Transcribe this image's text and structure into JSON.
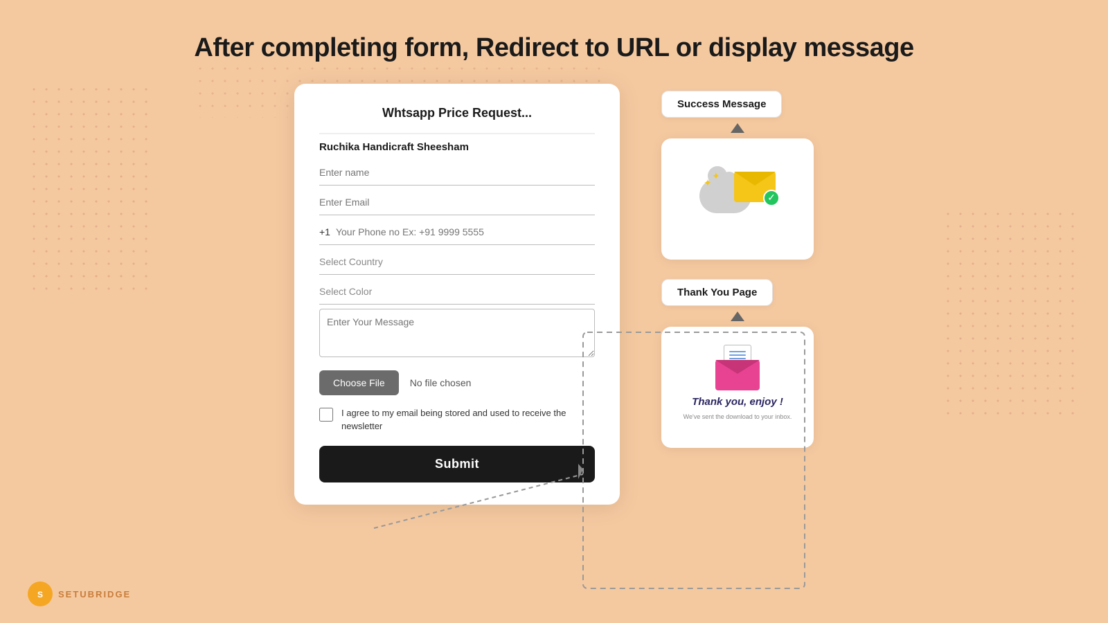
{
  "page": {
    "title": "After completing form, Redirect to URL or display message",
    "background_color": "#f5c9a0"
  },
  "form_card": {
    "title": "Whtsapp Price Request...",
    "subtitle": "Ruchika Handicraft Sheesham",
    "fields": {
      "name_placeholder": "Enter name",
      "email_placeholder": "Enter Email",
      "phone_prefix": "+1",
      "phone_placeholder": "Your Phone no Ex: +91 9999 5555",
      "country_placeholder": "Select Country",
      "color_placeholder": "Select Color",
      "message_placeholder": "Enter Your Message",
      "choose_file_label": "Choose File",
      "no_file_label": "No file chosen",
      "checkbox_label": "I agree to my email being stored and used to receive the newsletter",
      "submit_label": "Submit"
    }
  },
  "right_panel": {
    "success_label": "Success Message",
    "thankyou_label": "Thank You Page",
    "thankyou_text": "Thank you, enjoy !",
    "thankyou_sub": "We've sent the download to your inbox."
  },
  "logo": {
    "icon": "S",
    "text": "SETUBRIDGE"
  }
}
